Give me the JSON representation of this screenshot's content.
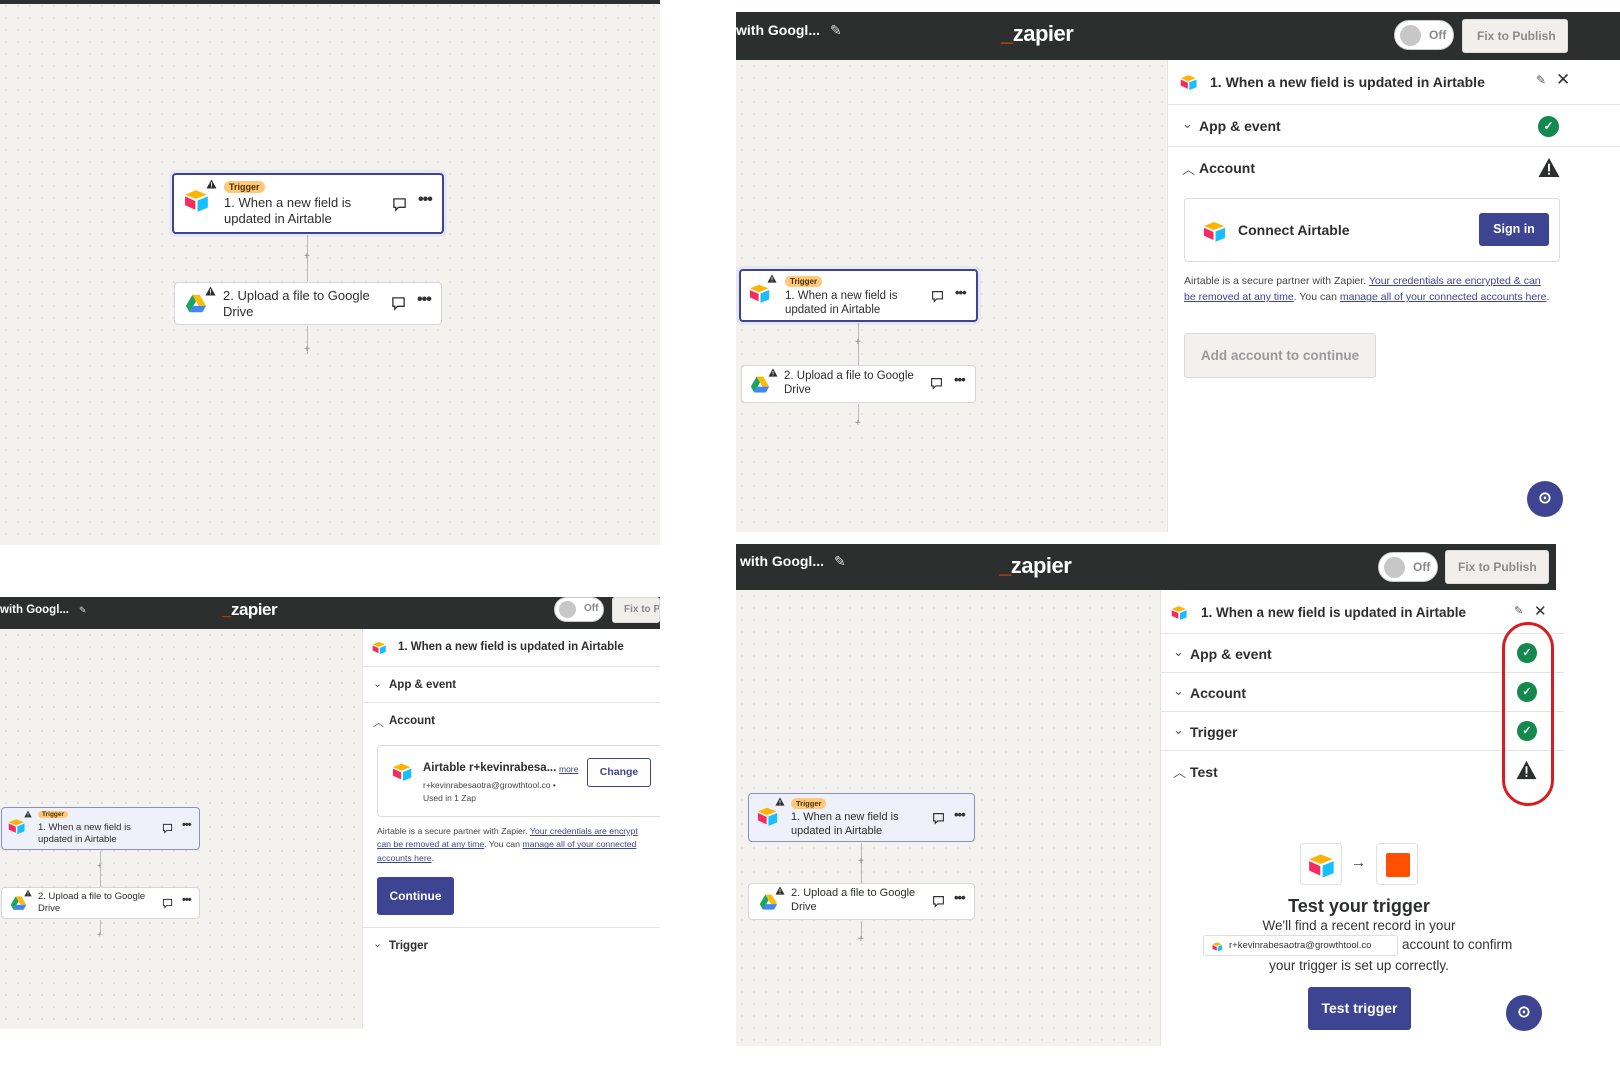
{
  "colors": {
    "brand_orange": "#ff4f00",
    "accent_indigo": "#3d4592",
    "topbar": "#2d2e2e",
    "success_green": "#13894d",
    "trigger_badge": "#ffc87a",
    "annotation_red": "#d81d22"
  },
  "icons": {
    "airtable": "airtable-icon",
    "google_drive": "google-drive-icon",
    "warning": "warning-icon",
    "check": "check-circle-icon",
    "comment": "comment-icon",
    "more": "more-dots-icon",
    "pencil": "pencil-icon",
    "close": "close-icon",
    "chevron": "chevron-icon",
    "help": "help-icon"
  },
  "topbar": {
    "zap_name": "with Googl...",
    "logo": "zapier",
    "toggle_label": "Off",
    "fix_button": "Fix to Publish",
    "fix_button_cut": "Fix to P"
  },
  "steps": {
    "badge": "Trigger",
    "step1": "1. When a new field is updated in Airtable",
    "step1_line1": "1. When a new field is",
    "step1_line2": "updated in Airtable",
    "step2_line1": "2. Upload a file to Google",
    "step2_line2": "Drive",
    "plus": "+"
  },
  "side": {
    "title": "1. When a new field is updated in Airtable",
    "sections": {
      "app_event": "App & event",
      "account": "Account",
      "trigger": "Trigger",
      "test": "Test"
    },
    "connect": {
      "label": "Connect Airtable",
      "signin": "Sign in"
    },
    "help": {
      "prefix": "Airtable is a secure partner with Zapier.",
      "link1": "Your credentials are encrypted & can be removed at any time",
      "link1_cut": "Your credentials are encrypt",
      "link1_cont": "can be removed at any time",
      "middle": ". You can",
      "link2": "manage all of your connected accounts here",
      "link2a": "manage all of your connected",
      "link2b": "accounts here",
      "suffix": "."
    },
    "add_account": "Add account to continue",
    "account_card": {
      "name": "Airtable r+kevinrabesa...",
      "more": "more",
      "email": "r+kevinrabesaotra@growthtool.co •",
      "used": "Used in 1 Zap",
      "change": "Change"
    },
    "continue": "Continue",
    "test": {
      "title": "Test your trigger",
      "line1": "We'll find a recent record in your",
      "chip_email": "r+kevinrabesaotra@growthtool.co",
      "line2_suffix": "account to confirm",
      "line3": "your trigger is set up correctly.",
      "button": "Test trigger",
      "arrow": "→"
    }
  }
}
